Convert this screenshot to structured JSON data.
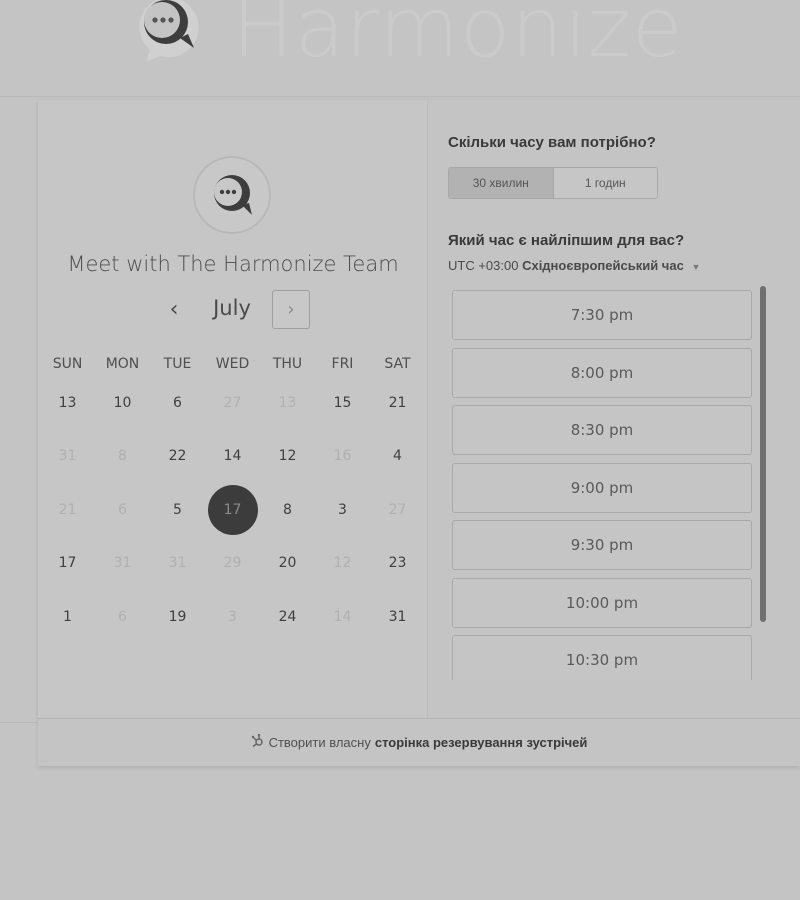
{
  "brand": {
    "name": "Harmonize",
    "logo_icon": "chat-bubble-logo-icon"
  },
  "scheduler": {
    "meet_title": "Meet with The Harmonize Team",
    "month": "July",
    "prev_label": "‹",
    "next_label": "›",
    "weekdays": [
      "SUN",
      "MON",
      "TUE",
      "WED",
      "THU",
      "FRI",
      "SAT"
    ],
    "weeks": [
      [
        {
          "d": "13",
          "dim": false
        },
        {
          "d": "10",
          "dim": false
        },
        {
          "d": "6",
          "dim": false
        },
        {
          "d": "27",
          "dim": true
        },
        {
          "d": "13",
          "dim": true
        },
        {
          "d": "15",
          "dim": false
        },
        {
          "d": "21",
          "dim": false
        }
      ],
      [
        {
          "d": "31",
          "dim": true
        },
        {
          "d": "8",
          "dim": true
        },
        {
          "d": "22",
          "dim": false
        },
        {
          "d": "14",
          "dim": false
        },
        {
          "d": "12",
          "dim": false
        },
        {
          "d": "16",
          "dim": true
        },
        {
          "d": "4",
          "dim": false
        }
      ],
      [
        {
          "d": "21",
          "dim": true
        },
        {
          "d": "6",
          "dim": true
        },
        {
          "d": "5",
          "dim": false
        },
        {
          "d": "17",
          "dim": false,
          "selected": true
        },
        {
          "d": "8",
          "dim": false
        },
        {
          "d": "3",
          "dim": false
        },
        {
          "d": "27",
          "dim": true
        }
      ],
      [
        {
          "d": "17",
          "dim": false
        },
        {
          "d": "31",
          "dim": true
        },
        {
          "d": "31",
          "dim": true
        },
        {
          "d": "29",
          "dim": true
        },
        {
          "d": "20",
          "dim": false
        },
        {
          "d": "12",
          "dim": true
        },
        {
          "d": "23",
          "dim": false
        }
      ],
      [
        {
          "d": "1",
          "dim": false
        },
        {
          "d": "6",
          "dim": true
        },
        {
          "d": "19",
          "dim": false
        },
        {
          "d": "3",
          "dim": true
        },
        {
          "d": "24",
          "dim": false
        },
        {
          "d": "14",
          "dim": true
        },
        {
          "d": "31",
          "dim": false
        }
      ]
    ]
  },
  "booking": {
    "duration_question": "Скільки часу вам потрібно?",
    "durations": [
      "30 хвилин",
      "1 годин"
    ],
    "selected_duration": "30 хвилин",
    "time_question": "Який час є найліпшим для вас?",
    "timezone_offset": "UTC +03:00",
    "timezone_name": "Східноєвропейський час",
    "slots": [
      "7:30 pm",
      "8:00 pm",
      "8:30 pm",
      "9:00 pm",
      "9:30 pm",
      "10:00 pm",
      "10:30 pm"
    ]
  },
  "footer": {
    "prefix": "Створити власну",
    "link": "сторінка резервування зустрічей",
    "icon": "sprocket-icon"
  },
  "colors": {
    "selected_day": "#3c3c3c",
    "background": "#c4c4c4"
  }
}
